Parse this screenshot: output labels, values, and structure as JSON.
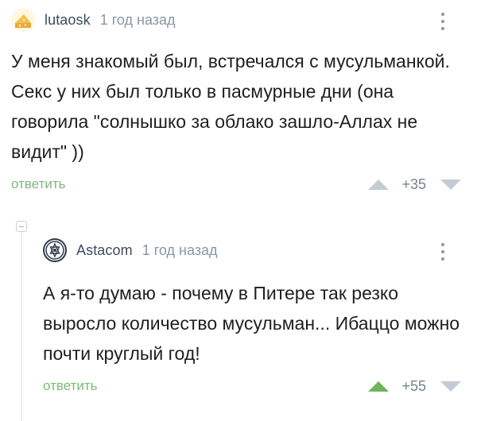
{
  "comments": [
    {
      "username": "lutaosk",
      "time": "1 год назад",
      "text": "У меня знакомый был, встречался с мусульманкой. Секс у них был только в пасмурные дни (она говорила \"солнышко за облако зашло-Аллах не видит\" ))",
      "reply_label": "ответить",
      "score": "+35",
      "avatar_icon": "cheese-avatar-icon"
    },
    {
      "username": "Astacom",
      "time": "1 год назад",
      "text": "А я-то думаю - почему в Питере так резко выросло количество мусульман... Ибаццо можно почти круглый год!",
      "reply_label": "ответить",
      "score": "+55",
      "avatar_icon": "star-emblem-avatar-icon"
    }
  ],
  "colors": {
    "reply_green": "#7fb97a",
    "upvote_active": "#70b35a",
    "vote_inactive": "#c4cbd3"
  }
}
